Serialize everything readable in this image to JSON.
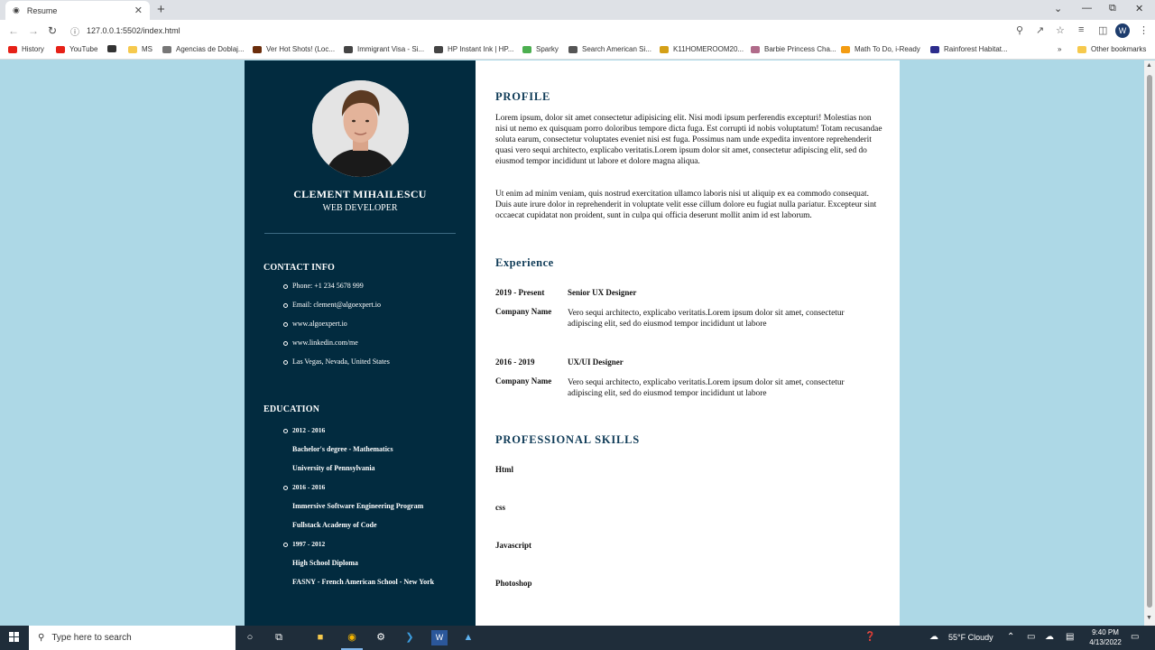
{
  "browser": {
    "tab_title": "Resume",
    "url": "127.0.0.1:5502/index.html",
    "bookmarks": [
      {
        "label": "History",
        "color": "#e62117"
      },
      {
        "label": "YouTube",
        "color": "#e62117"
      },
      {
        "label": "",
        "color": "#333333"
      },
      {
        "label": "MS",
        "color": "#f6c94d"
      },
      {
        "label": "Agencias de Doblaj...",
        "color": "#777777"
      },
      {
        "label": "Ver Hot Shots! (Loc...",
        "color": "#6b2d0b"
      },
      {
        "label": "Immigrant Visa - Si...",
        "color": "#444444"
      },
      {
        "label": "HP Instant Ink | HP...",
        "color": "#444444"
      },
      {
        "label": "Sparky",
        "color": "#4caf50"
      },
      {
        "label": "Search American Si...",
        "color": "#555555"
      },
      {
        "label": "K11HOMEROOM20...",
        "color": "#d4a017"
      },
      {
        "label": "Barbie Princess Cha...",
        "color": "#b06b8a"
      },
      {
        "label": "Math To Do, i-Ready",
        "color": "#f39c12"
      },
      {
        "label": "Rainforest Habitat...",
        "color": "#2c2c8c"
      }
    ],
    "other_bookmarks": "Other bookmarks"
  },
  "resume": {
    "name": "CLEMENT MIHAILESCU",
    "role": "WEB DEVELOPER",
    "contact_title": "CONTACT INFO",
    "contact": [
      "Phone: +1 234 5678 999",
      "Email: clement@algoexpert.io",
      "www.algoexpert.io",
      "www.linkedin.com/me",
      "Las Vegas, Nevada, United States"
    ],
    "education_title": "EDUCATION",
    "education": [
      {
        "years": "2012 - 2016",
        "degree": "Bachelor's degree - Mathematics",
        "school": "University of Pennsylvania"
      },
      {
        "years": "2016 - 2016",
        "degree": "Immersive Software Engineering Program",
        "school": "Fullstack Academy of Code"
      },
      {
        "years": "1997 - 2012",
        "degree": "High School Diploma",
        "school": "FASNY - French American School - New York"
      }
    ],
    "profile_title": "PROFILE",
    "profile_p1": "Lorem ipsum, dolor sit amet consectetur adipisicing elit. Nisi modi ipsum perferendis excepturi! Molestias non nisi ut nemo ex quisquam porro doloribus tempore dicta fuga. Est corrupti id nobis voluptatum! Totam recusandae soluta earum, consectetur voluptates eveniet nisi est fuga. Possimus nam unde expedita inventore reprehenderit quasi vero sequi architecto, explicabo veritatis.Lorem ipsum dolor sit amet, consectetur adipiscing elit, sed do eiusmod tempor incididunt ut labore et dolore magna aliqua.",
    "profile_p2": "Ut enim ad minim veniam, quis nostrud exercitation ullamco laboris nisi ut aliquip ex ea commodo consequat. Duis aute irure dolor in reprehenderit in voluptate velit esse cillum dolore eu fugiat nulla pariatur. Excepteur sint occaecat cupidatat non proident, sunt in culpa qui officia deserunt mollit anim id est laborum.",
    "experience_title": "Experience",
    "experience": [
      {
        "years": "2019 - Present",
        "title": "Senior UX Designer",
        "company": "Company Name",
        "desc": "Vero sequi architecto, explicabo veritatis.Lorem ipsum dolor sit amet, consectetur adipiscing elit, sed do eiusmod tempor incididunt ut labore"
      },
      {
        "years": "2016 - 2019",
        "title": "UX/UI Designer",
        "company": "Company Name",
        "desc": "Vero sequi architecto, explicabo veritatis.Lorem ipsum dolor sit amet, consectetur adipiscing elit, sed do eiusmod tempor incididunt ut labore"
      }
    ],
    "skills_title": "PROFESSIONAL SKILLS",
    "skills": [
      "Html",
      "css",
      "Javascript",
      "Photoshop"
    ]
  },
  "taskbar": {
    "search_placeholder": "Type here to search",
    "weather": "55°F  Cloudy",
    "time": "9:40 PM",
    "date": "4/13/2022"
  }
}
